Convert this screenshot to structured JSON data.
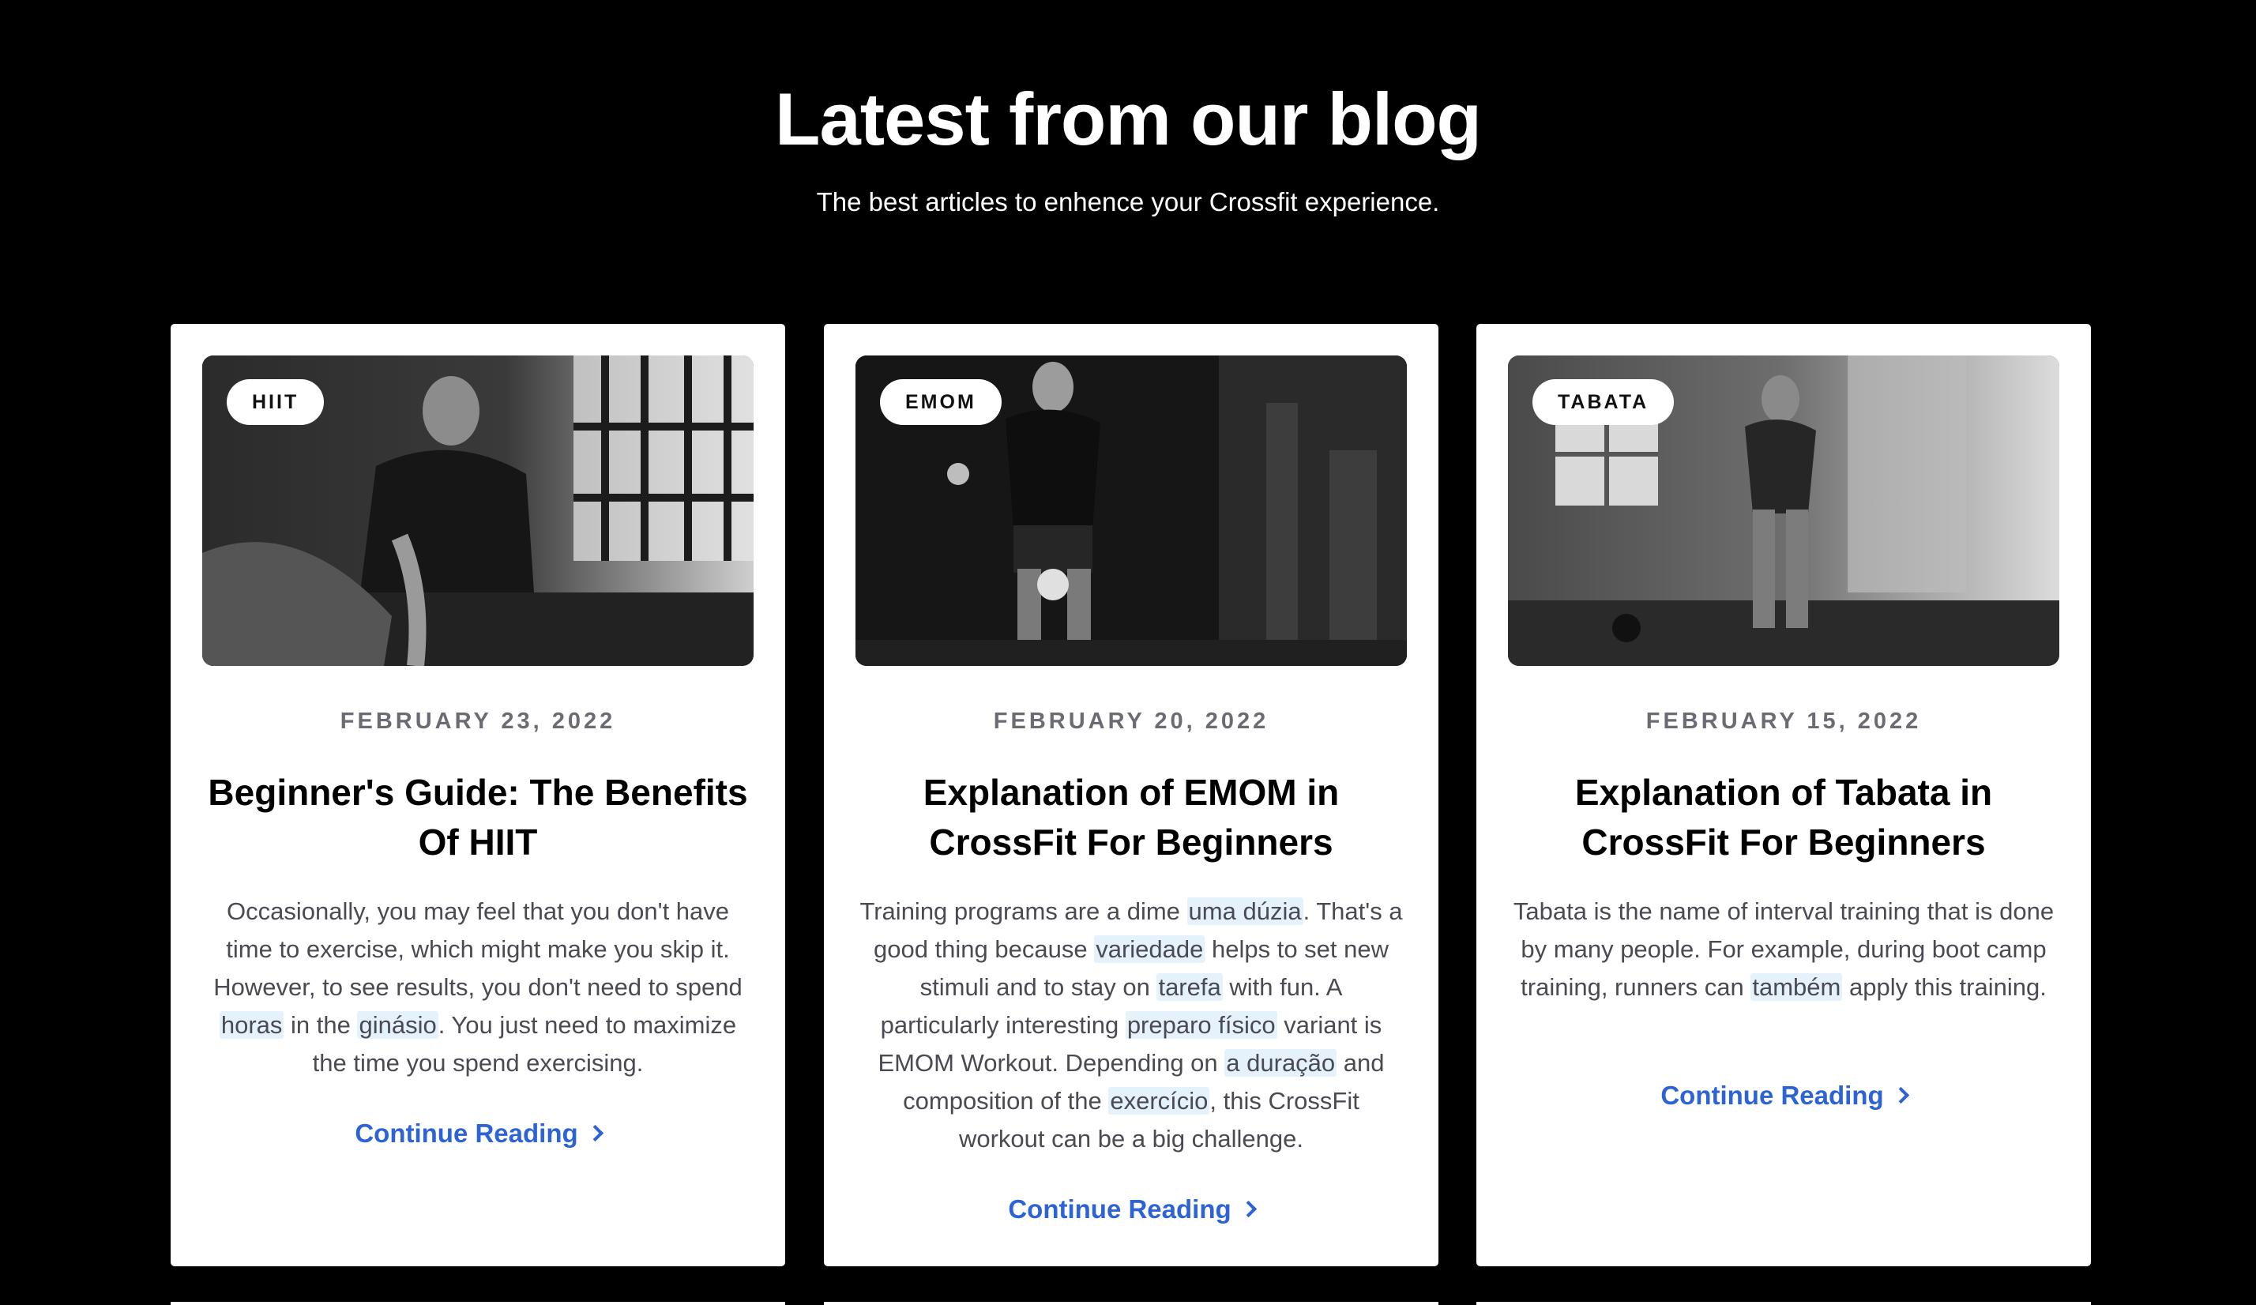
{
  "section": {
    "title": "Latest from our blog",
    "subtitle": "The best articles to enhence your Crossfit experience."
  },
  "colors": {
    "background": "#000000",
    "card": "#ffffff",
    "link": "#2d63d4",
    "date": "#6b6b73",
    "highlight": "#e6f2fb"
  },
  "posts": [
    {
      "tag": "HIIT",
      "date": "FEBRUARY 23, 2022",
      "title": "Beginner's Guide: The Benefits Of HIIT",
      "excerpt": [
        {
          "text": "Occasionally, you may feel that you don't have time to exercise, which might make you skip it. However, to see results, you don't need to spend ",
          "hl": false
        },
        {
          "text": "horas",
          "hl": true
        },
        {
          "text": " in the ",
          "hl": false
        },
        {
          "text": "ginásio",
          "hl": true
        },
        {
          "text": ". You just need to maximize the time you spend exercising.",
          "hl": false
        }
      ],
      "cta": "Continue Reading",
      "image_icon": "battle-ropes-photo"
    },
    {
      "tag": "EMOM",
      "date": "FEBRUARY 20, 2022",
      "title": "Explanation of EMOM in CrossFit For Beginners",
      "excerpt": [
        {
          "text": "Training programs are a dime ",
          "hl": false
        },
        {
          "text": "uma dúzia",
          "hl": true
        },
        {
          "text": ". That's a good thing because ",
          "hl": false
        },
        {
          "text": "variedade",
          "hl": true
        },
        {
          "text": " helps to set new stimuli and to stay on ",
          "hl": false
        },
        {
          "text": "tarefa",
          "hl": true
        },
        {
          "text": " with fun. A particularly interesting ",
          "hl": false
        },
        {
          "text": "preparo físico",
          "hl": true
        },
        {
          "text": " variant is EMOM Workout. Depending on ",
          "hl": false
        },
        {
          "text": "a duração",
          "hl": true
        },
        {
          "text": " and composition of the ",
          "hl": false
        },
        {
          "text": "exercício",
          "hl": true
        },
        {
          "text": ", this CrossFit workout can be a big challenge.",
          "hl": false
        }
      ],
      "cta": "Continue Reading",
      "image_icon": "kettlebell-swing-photo"
    },
    {
      "tag": "TABATA",
      "date": "FEBRUARY 15, 2022",
      "title": "Explanation of Tabata in CrossFit For Beginners",
      "excerpt": [
        {
          "text": "Tabata is the name of interval training that is done by many people. For example, during boot camp training, runners can ",
          "hl": false
        },
        {
          "text": "também",
          "hl": true
        },
        {
          "text": " apply this training.",
          "hl": false
        }
      ],
      "cta": "Continue Reading",
      "image_icon": "athlete-resting-photo"
    }
  ]
}
